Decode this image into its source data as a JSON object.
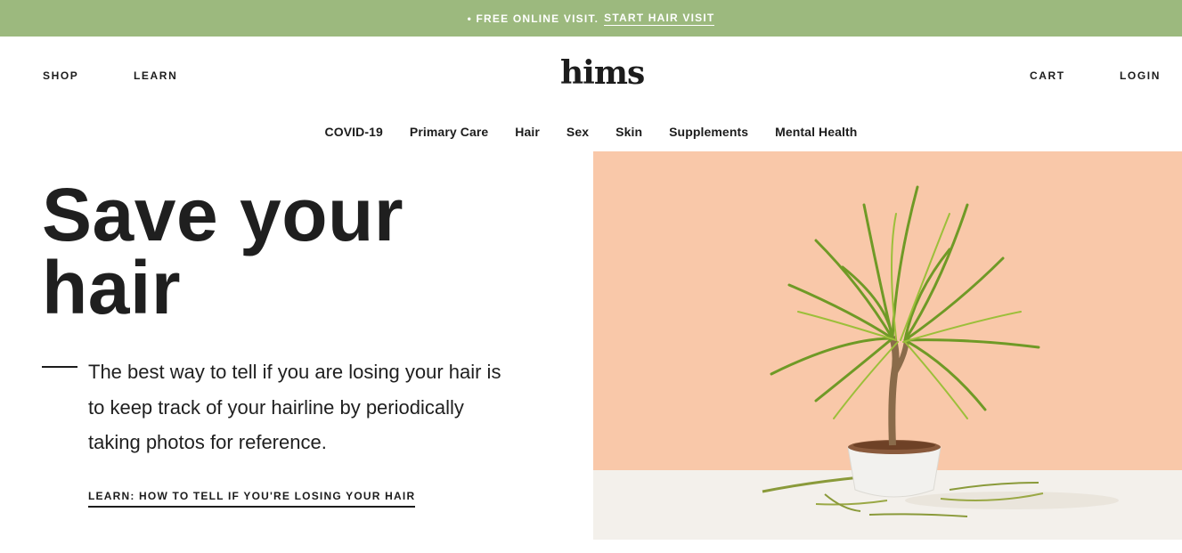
{
  "promo": {
    "text": "• FREE ONLINE VISIT.",
    "link_label": "START HAIR VISIT"
  },
  "header": {
    "shop_label": "SHOP",
    "learn_label": "LEARN",
    "logo_text": "hims",
    "cart_label": "CART",
    "login_label": "LOGIN"
  },
  "category_nav": {
    "items": [
      "COVID-19",
      "Primary Care",
      "Hair",
      "Sex",
      "Skin",
      "Supplements",
      "Mental Health"
    ]
  },
  "hero": {
    "title_line1": "Save your",
    "title_line2": "hair",
    "description": "The best way to tell if you are losing your hair is to keep track of your hairline by periodically taking photos for reference.",
    "cta_label": "LEARN: HOW TO TELL IF YOU'RE LOSING YOUR HAIR",
    "image_name": "potted-dracaena-plant",
    "image_bg_color": "#f9c8a9",
    "image_floor_color": "#f3f0eb"
  },
  "colors": {
    "promo_bg": "#9cb97e",
    "text": "#1c1c1c"
  }
}
